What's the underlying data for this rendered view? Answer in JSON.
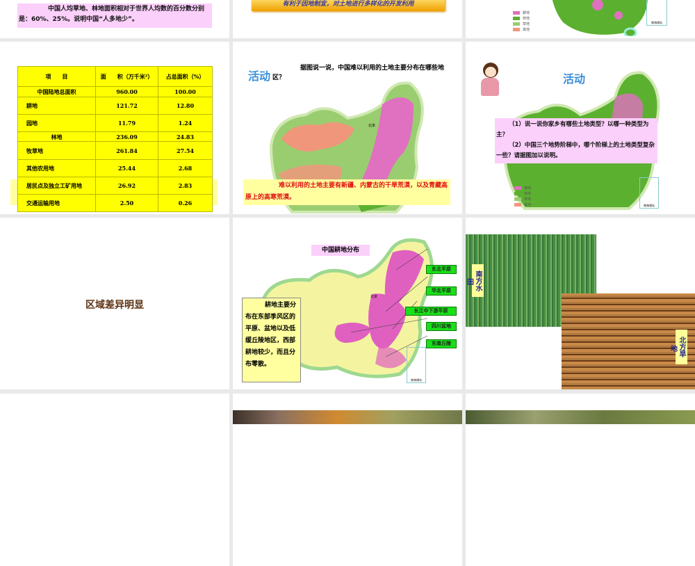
{
  "slides": [
    {
      "pink_text": "中国人均草地、林地面积相对于世界人均数的百分数分别是：60%、25%。说明中国“人多地少”。"
    },
    {
      "banner_text": "有利于因地制宜，对土地进行多样化的开发利用"
    },
    {
      "legend": [
        "耕地",
        "林地",
        "草地",
        "其他"
      ],
      "inset_label": "南海诸岛"
    },
    {
      "table": {
        "headers": [
          "项　　目",
          "面　　积（万千米²）",
          "占总面积（%）"
        ],
        "rows": [
          [
            "中国陆地总面积",
            "960.00",
            "100.00"
          ],
          [
            "耕地",
            "121.72",
            "12.80"
          ],
          [
            "园地",
            "11.79",
            "1.24"
          ],
          [
            "林地",
            "236.09",
            "24.83"
          ],
          [
            "牧草地",
            "261.84",
            "27.54"
          ],
          [
            "其他农用地",
            "25.44",
            "2.68"
          ],
          [
            "居民点及独立工矿用地",
            "26.92",
            "2.83"
          ],
          [
            "交通运输用地",
            "2.50",
            "0.26"
          ]
        ]
      }
    },
    {
      "title": "活动",
      "question": "据图说一说，中国难以利用的土地主要分布在哪些地区？",
      "map_label": "北京",
      "answer": "难以利用的土地主要有新疆、内蒙古的干旱荒漠，以及青藏高原上的高寒荒漠。"
    },
    {
      "title": "活动",
      "q1": "（1）说一说你家乡有哪些土地类型？以哪一种类型为主？",
      "q2": "（2）中国三个地势阶梯中，哪个阶梯上的土地类型复杂一些？请据图加以说明。",
      "legend": [
        "耕地",
        "林地",
        "草地",
        "其他"
      ],
      "inset_label": "南海诸岛"
    },
    {
      "heading": "区域差异明显"
    },
    {
      "title": "中国耕地分布",
      "map_label": "北京",
      "note": "耕地主要分布在东部季风区的平原、盆地以及低缓丘陵地区，西部耕地较少，而且分布零散。",
      "labels": [
        "东北平原",
        "华北平原",
        "长江中下游平原",
        "四川盆地",
        "东南丘陵"
      ],
      "inset_label": "南海诸岛"
    },
    {
      "south_label": "南方水",
      "south_tail": "田",
      "north_label": "北方旱",
      "north_tail": "地"
    }
  ],
  "colors": {
    "background": "#e9e9e9",
    "pink": "#fbd0fb",
    "yellow": "#ffff00",
    "cropland": "#e070c0",
    "forest": "#5cb030",
    "grass": "#9acd70",
    "other": "#f0967a"
  }
}
